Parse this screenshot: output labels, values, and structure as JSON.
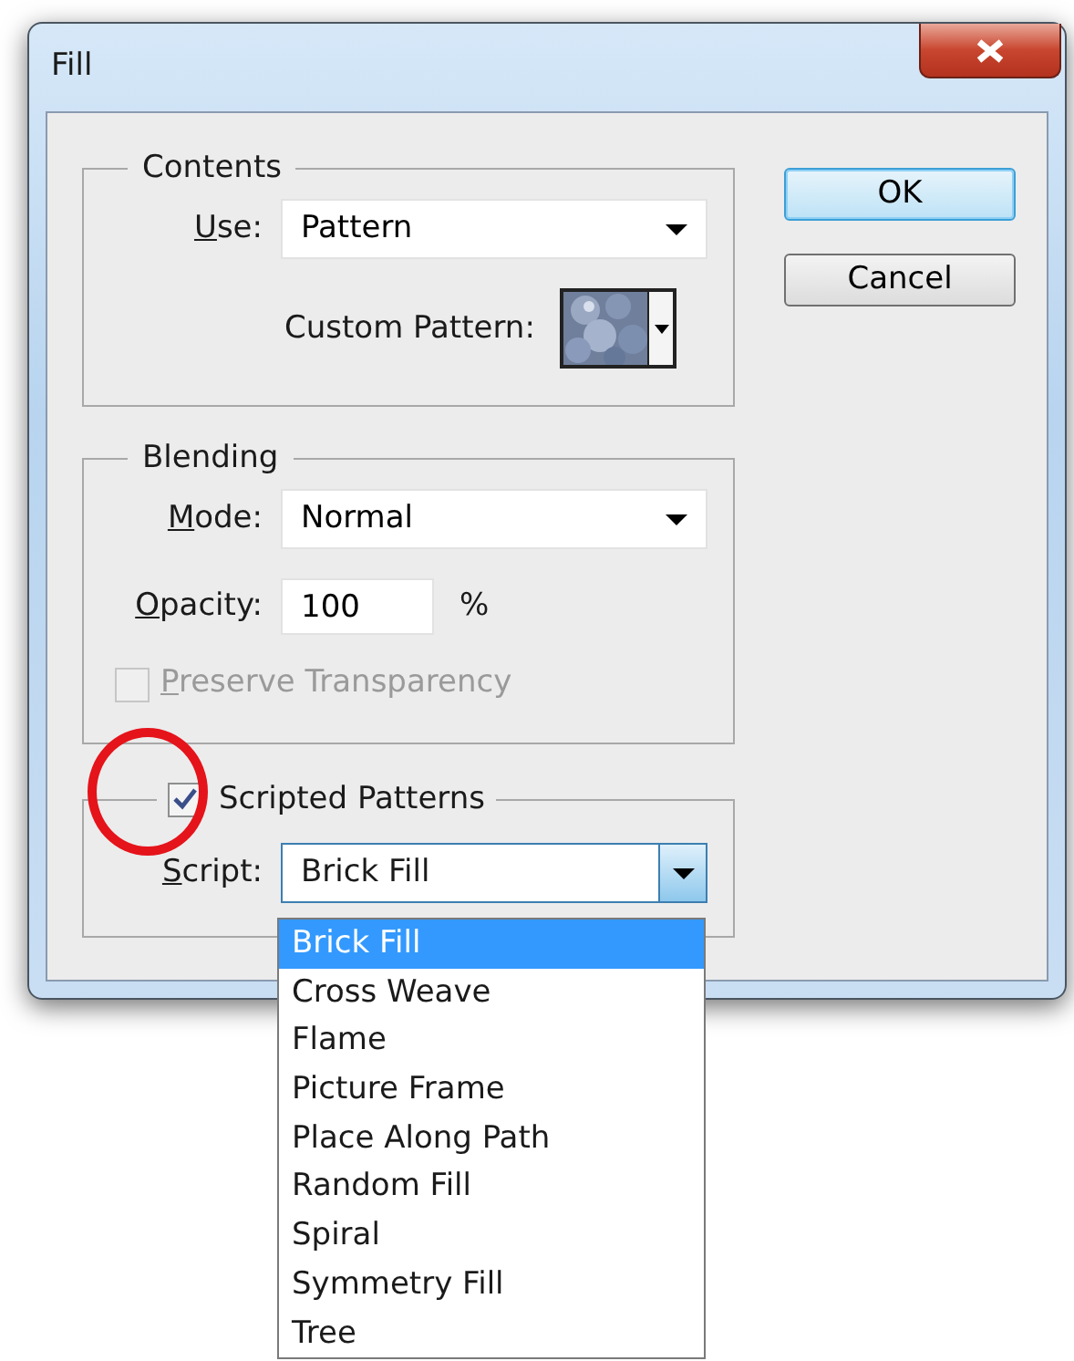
{
  "window": {
    "title": "Fill"
  },
  "contents": {
    "title": "Contents",
    "use": {
      "label": "Use:",
      "access_key": true,
      "value": "Pattern"
    },
    "custom_pattern": {
      "label": "Custom Pattern:",
      "access_key": false
    }
  },
  "blending": {
    "title": "Blending",
    "mode": {
      "label": "Mode:",
      "access_key": true,
      "value": "Normal"
    },
    "opacity": {
      "label": "Opacity:",
      "access_key": true,
      "value": "100",
      "unit": "%"
    },
    "preserve_transparency": {
      "label": "Preserve Transparency",
      "access_key": true,
      "checked": false,
      "disabled": true
    }
  },
  "scripted_patterns": {
    "label": "Scripted Patterns",
    "checked": true,
    "script": {
      "label": "Script:",
      "access_key": true,
      "value": "Brick Fill",
      "expanded": true,
      "options": [
        {
          "label": "Brick Fill",
          "selected": true
        },
        {
          "label": "Cross Weave",
          "selected": false
        },
        {
          "label": "Flame",
          "selected": false
        },
        {
          "label": "Picture Frame",
          "selected": false
        },
        {
          "label": "Place Along Path",
          "selected": false
        },
        {
          "label": "Random Fill",
          "selected": false
        },
        {
          "label": "Spiral",
          "selected": false
        },
        {
          "label": "Symmetry Fill",
          "selected": false
        },
        {
          "label": "Tree",
          "selected": false
        }
      ]
    }
  },
  "buttons": [
    {
      "label": "OK",
      "default": true
    },
    {
      "label": "Cancel",
      "default": false
    }
  ],
  "annotation": {
    "kind": "circle"
  }
}
